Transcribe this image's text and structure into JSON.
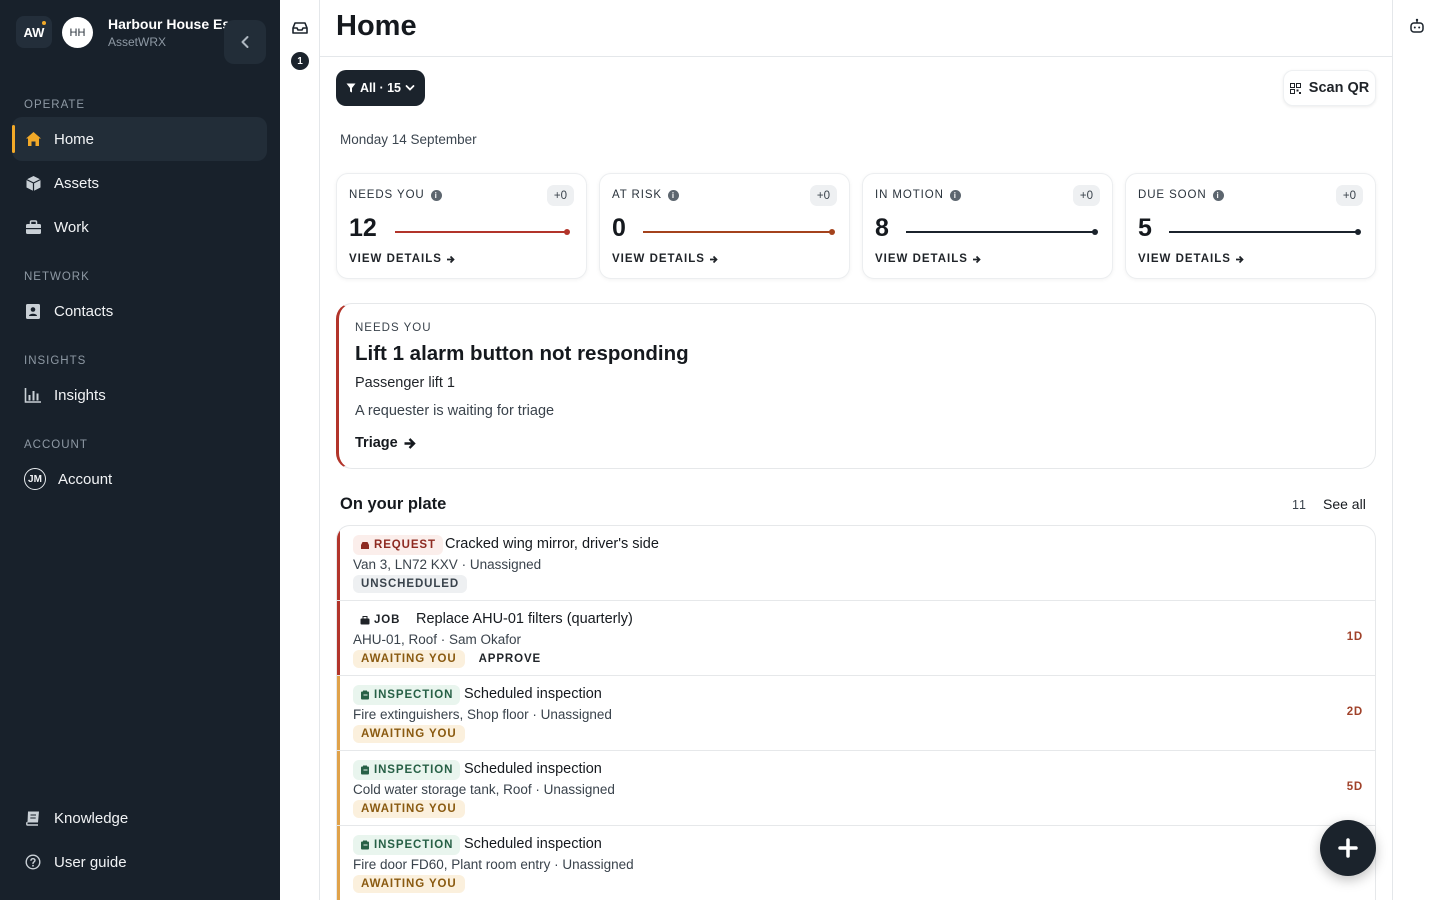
{
  "workspace": {
    "logo": "AW",
    "avatar": "HH",
    "name": "Harbour House Es...",
    "sub": "AssetWRX"
  },
  "sidebar": {
    "sections": [
      "OPERATE",
      "NETWORK",
      "INSIGHTS",
      "ACCOUNT"
    ],
    "items": [
      {
        "label": "Home",
        "icon": "home-icon"
      },
      {
        "label": "Assets",
        "icon": "box-icon"
      },
      {
        "label": "Work",
        "icon": "briefcase-icon"
      },
      {
        "label": "Contacts",
        "icon": "contacts-icon"
      },
      {
        "label": "Insights",
        "icon": "bar-chart-icon"
      },
      {
        "label": "Account",
        "avatar": "JM"
      }
    ],
    "footer": [
      {
        "label": "Knowledge",
        "icon": "book-icon"
      },
      {
        "label": "User guide",
        "icon": "help-icon"
      }
    ]
  },
  "rail": {
    "count": "1"
  },
  "header": {
    "title": "Home"
  },
  "toolbar": {
    "filter_label": "All · 15",
    "scan_label": "Scan QR"
  },
  "date": "Monday 14 September",
  "stats": [
    {
      "label": "NEEDS YOU",
      "delta": "+0",
      "value": "12",
      "link": "VIEW DETAILS",
      "color": "#b2342a"
    },
    {
      "label": "AT RISK",
      "delta": "+0",
      "value": "0",
      "link": "VIEW DETAILS",
      "color": "#a4421c"
    },
    {
      "label": "IN MOTION",
      "delta": "+0",
      "value": "8",
      "link": "VIEW DETAILS",
      "color": "#1b232c"
    },
    {
      "label": "DUE SOON",
      "delta": "+0",
      "value": "5",
      "link": "VIEW DETAILS",
      "color": "#1b232c"
    }
  ],
  "alert": {
    "kicker": "NEEDS YOU",
    "title": "Lift 1 alarm button not responding",
    "subtitle": "Passenger lift 1",
    "note": "A requester is waiting for triage",
    "action": "Triage"
  },
  "plate": {
    "title": "On your plate",
    "count": "11",
    "see_all": "See all",
    "rows": [
      {
        "type": "REQUEST",
        "title": "Cracked wing mirror, driver's side",
        "sub": "Van 3, LN72 KXV · Unassigned",
        "tags": [
          "UNSCHEDULED"
        ],
        "due": ""
      },
      {
        "type": "JOB",
        "title": "Replace AHU-01 filters (quarterly)",
        "sub": "AHU-01, Roof · Sam Okafor",
        "tags": [
          "AWAITING YOU",
          "APPROVE"
        ],
        "due": "1D"
      },
      {
        "type": "INSPECTION",
        "title": "Scheduled inspection",
        "sub": "Fire extinguishers, Shop floor · Unassigned",
        "tags": [
          "AWAITING YOU"
        ],
        "due": "2D"
      },
      {
        "type": "INSPECTION",
        "title": "Scheduled inspection",
        "sub": "Cold water storage tank, Roof · Unassigned",
        "tags": [
          "AWAITING YOU"
        ],
        "due": "5D"
      },
      {
        "type": "INSPECTION",
        "title": "Scheduled inspection",
        "sub": "Fire door FD60, Plant room entry · Unassigned",
        "tags": [
          "AWAITING YOU"
        ],
        "due": ""
      }
    ]
  },
  "colors": {
    "sidebar_bg": "#18212b",
    "accent": "#f2a928",
    "danger": "#b2342a",
    "amber": "#e0a24a"
  }
}
